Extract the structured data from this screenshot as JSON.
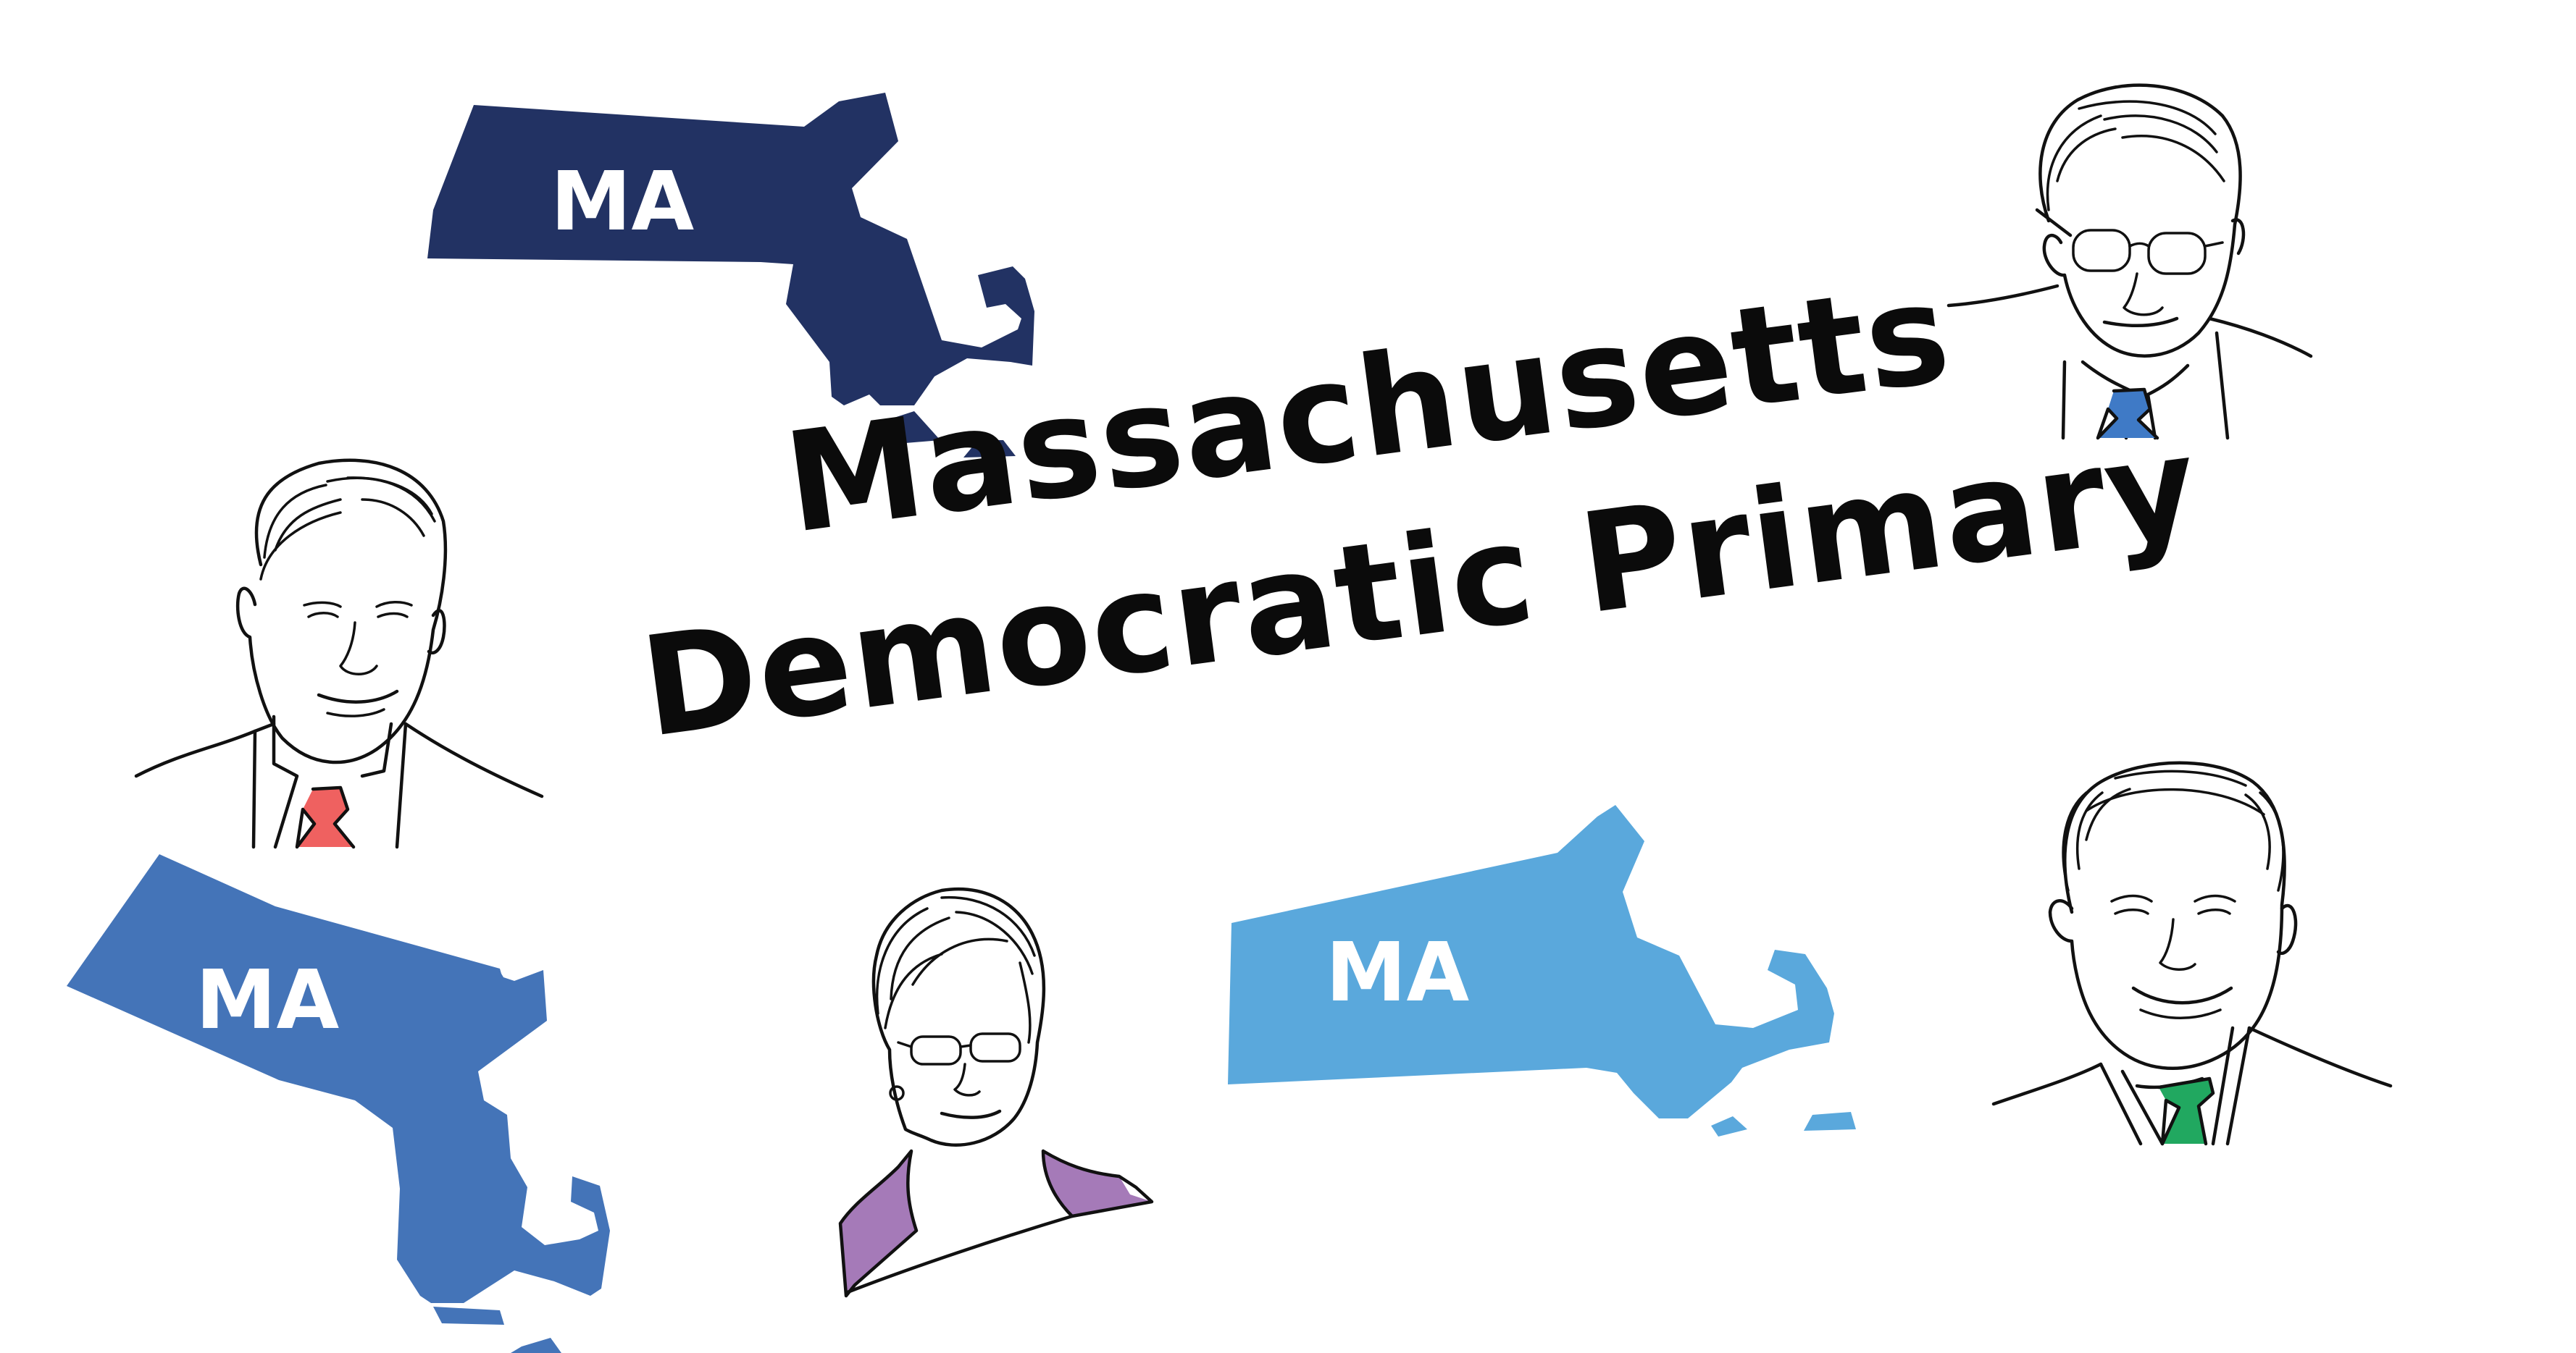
{
  "title": {
    "line1": "Massachusetts",
    "line2": "Democratic Primary"
  },
  "map_label": "MA",
  "colors": {
    "map_dark": "#223263",
    "map_mid": "#4474b8",
    "map_light": "#5aa8dc",
    "tie_red": "#ef6160",
    "tie_blue": "#3f7ac6",
    "tie_green": "#21a860",
    "jacket_purple": "#a57ab8"
  },
  "illustrations": [
    {
      "icon": "state-map-icon"
    },
    {
      "icon": "candidate-portrait-icon"
    }
  ]
}
